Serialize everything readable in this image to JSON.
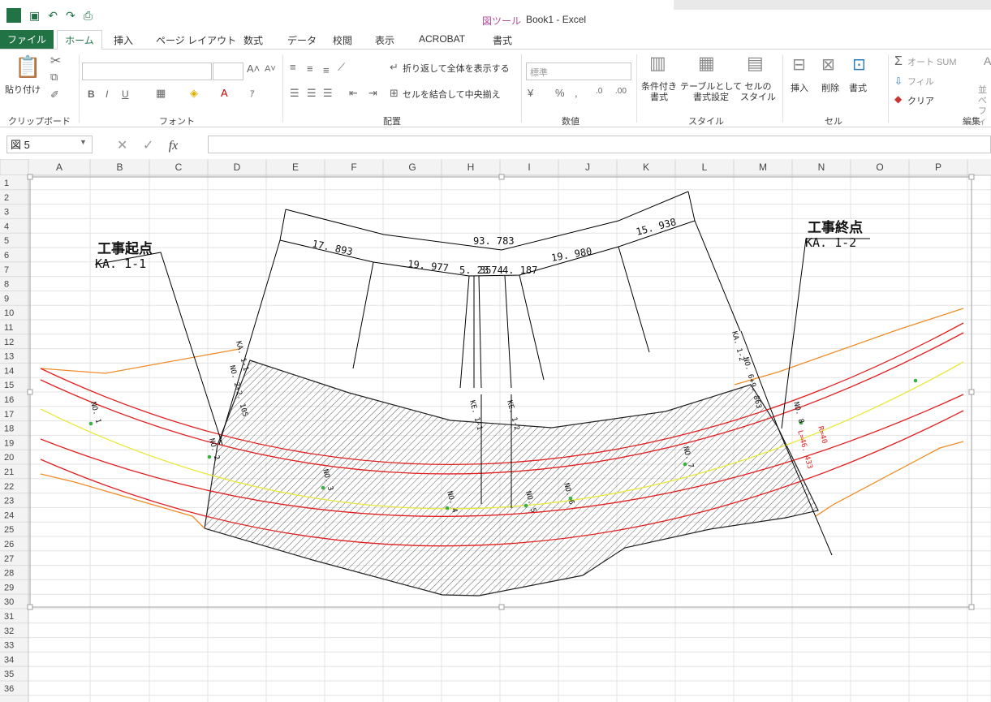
{
  "window": {
    "title": "Book1 - Excel",
    "context_tab": "図ツール"
  },
  "tabs": [
    {
      "label": "ファイル"
    },
    {
      "label": "ホーム"
    },
    {
      "label": "挿入"
    },
    {
      "label": "ページ レイアウト"
    },
    {
      "label": "数式"
    },
    {
      "label": "データ"
    },
    {
      "label": "校閲"
    },
    {
      "label": "表示"
    },
    {
      "label": "ACROBAT"
    },
    {
      "label": "書式"
    }
  ],
  "ribbon": {
    "clipboard": {
      "label": "クリップボード",
      "paste": "貼り付け"
    },
    "font": {
      "label": "フォント"
    },
    "alignment": {
      "label": "配置",
      "wrap": "折り返して全体を表示する",
      "merge": "セルを結合して中央揃え"
    },
    "number": {
      "label": "数値",
      "format": "標準"
    },
    "styles": {
      "label": "スタイル",
      "conditional_1": "条件付き",
      "conditional_2": "書式",
      "table_1": "テーブルとして",
      "table_2": "書式設定",
      "cell_1": "セルの",
      "cell_2": "スタイル"
    },
    "cells": {
      "label": "セル",
      "insert": "挿入",
      "delete": "削除",
      "format": "書式"
    },
    "editing": {
      "label": "編集",
      "autosum": "オート SUM",
      "fill": "フィル",
      "clear": "クリア",
      "sort_1": "並べ",
      "sort_2": "フィル"
    }
  },
  "formula_bar": {
    "name_box": "図 5",
    "fx": "fx",
    "value": ""
  },
  "columns": [
    "A",
    "B",
    "C",
    "D",
    "E",
    "F",
    "G",
    "H",
    "I",
    "J",
    "K",
    "L",
    "M",
    "N",
    "O",
    "P"
  ],
  "rows": [
    "1",
    "2",
    "3",
    "4",
    "5",
    "6",
    "7",
    "8",
    "9",
    "10",
    "11",
    "12",
    "13",
    "14",
    "15",
    "16",
    "17",
    "18",
    "19",
    "20",
    "21",
    "22",
    "23",
    "24",
    "25",
    "26",
    "27",
    "28",
    "29",
    "30",
    "31",
    "32",
    "33",
    "34",
    "35",
    "36"
  ],
  "drawing": {
    "start_title": "工事起点",
    "start_code": "KA. 1-1",
    "end_title": "工事終点",
    "end_code": "KA. 1-2",
    "dimensions": {
      "total": "93. 783",
      "seg1": "17. 893",
      "seg2": "19. 977",
      "seg3": "5. 23",
      "seg4": "3574",
      "seg5": "4. 187",
      "seg6": "19. 980",
      "seg7": "15. 938"
    },
    "station_labels": [
      "NO. 1",
      "NO. 2",
      "NO. 3",
      "NO. 4",
      "NO. 5",
      "NO. 6",
      "NO. 7",
      "NO. 8"
    ],
    "side_labels": [
      "KA. 1-1",
      "NO. 2+2. 105",
      "KE. 1-1",
      "KE. 1-2",
      "KA. 1-2",
      "NO. 6+9. 863",
      "R=40",
      "L=46. 433"
    ],
    "colors": {
      "red": "#e02020",
      "orange": "#f08c28",
      "yellow": "#e8e83a",
      "green": "#3cb043",
      "black": "#000000",
      "accent": "#217346"
    }
  }
}
